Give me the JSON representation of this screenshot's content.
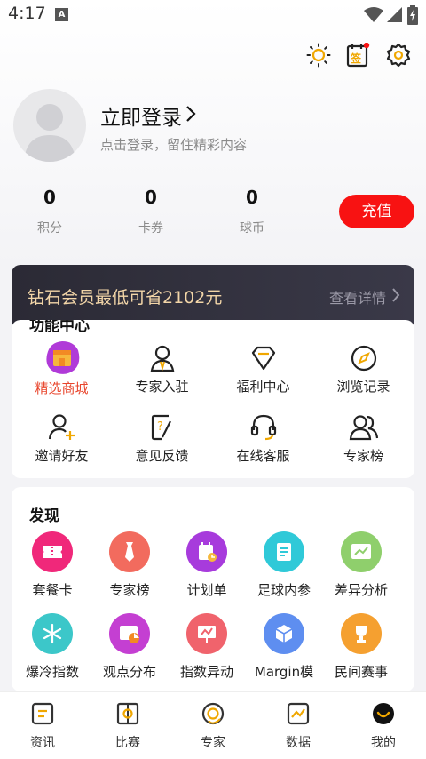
{
  "status": {
    "time": "4:17",
    "notif_letter": "A"
  },
  "top_icons": [
    "sun-icon",
    "sign-in-calendar-icon",
    "gear-icon"
  ],
  "sign_badge": "签",
  "profile": {
    "title": "立即登录",
    "subtitle": "点击登录，留住精彩内容"
  },
  "stats": [
    {
      "value": "0",
      "label": "积分"
    },
    {
      "value": "0",
      "label": "卡券"
    },
    {
      "value": "0",
      "label": "球币"
    }
  ],
  "recharge_label": "充值",
  "vip": {
    "text": "钻石会员最低可省2102元",
    "more": "查看详情"
  },
  "functions": {
    "title": "功能中心",
    "items": [
      {
        "label": "精选商城",
        "icon": "store-icon",
        "active": true
      },
      {
        "label": "专家入驻",
        "icon": "expert-join-icon"
      },
      {
        "label": "福利中心",
        "icon": "diamond-icon"
      },
      {
        "label": "浏览记录",
        "icon": "compass-icon"
      },
      {
        "label": "邀请好友",
        "icon": "add-user-icon"
      },
      {
        "label": "意见反馈",
        "icon": "feedback-icon"
      },
      {
        "label": "在线客服",
        "icon": "headset-icon"
      },
      {
        "label": "专家榜",
        "icon": "users-icon"
      }
    ]
  },
  "discover": {
    "title": "发现",
    "items": [
      {
        "label": "套餐卡",
        "icon": "ticket-icon",
        "color": "#f0287a"
      },
      {
        "label": "专家榜",
        "icon": "tie-icon",
        "color": "#f26b5e"
      },
      {
        "label": "计划单",
        "icon": "plan-calendar-icon",
        "color": "#a73bdc"
      },
      {
        "label": "足球内参",
        "icon": "document-icon",
        "color": "#2fc9d8"
      },
      {
        "label": "差异分析",
        "icon": "chart-card-icon",
        "color": "#8fcf6c"
      },
      {
        "label": "爆冷指数",
        "icon": "snowflake-icon",
        "color": "#3cc7c9"
      },
      {
        "label": "观点分布",
        "icon": "pie-chart-icon",
        "color": "#c43fd2"
      },
      {
        "label": "指数异动",
        "icon": "trend-board-icon",
        "color": "#f0636c"
      },
      {
        "label": "Margin模",
        "icon": "cube-icon",
        "color": "#5e8ef0"
      },
      {
        "label": "民间赛事",
        "icon": "trophy-icon",
        "color": "#f5a030"
      }
    ]
  },
  "nav": [
    {
      "label": "资讯",
      "icon": "news-icon"
    },
    {
      "label": "比赛",
      "icon": "match-icon"
    },
    {
      "label": "专家",
      "icon": "expert-icon"
    },
    {
      "label": "数据",
      "icon": "data-chart-icon"
    },
    {
      "label": "我的",
      "icon": "mine-face-icon"
    }
  ],
  "colors": {
    "accent_red": "#f81212",
    "vip_gold": "#f3d6a8",
    "active_orange": "#e8452c"
  }
}
